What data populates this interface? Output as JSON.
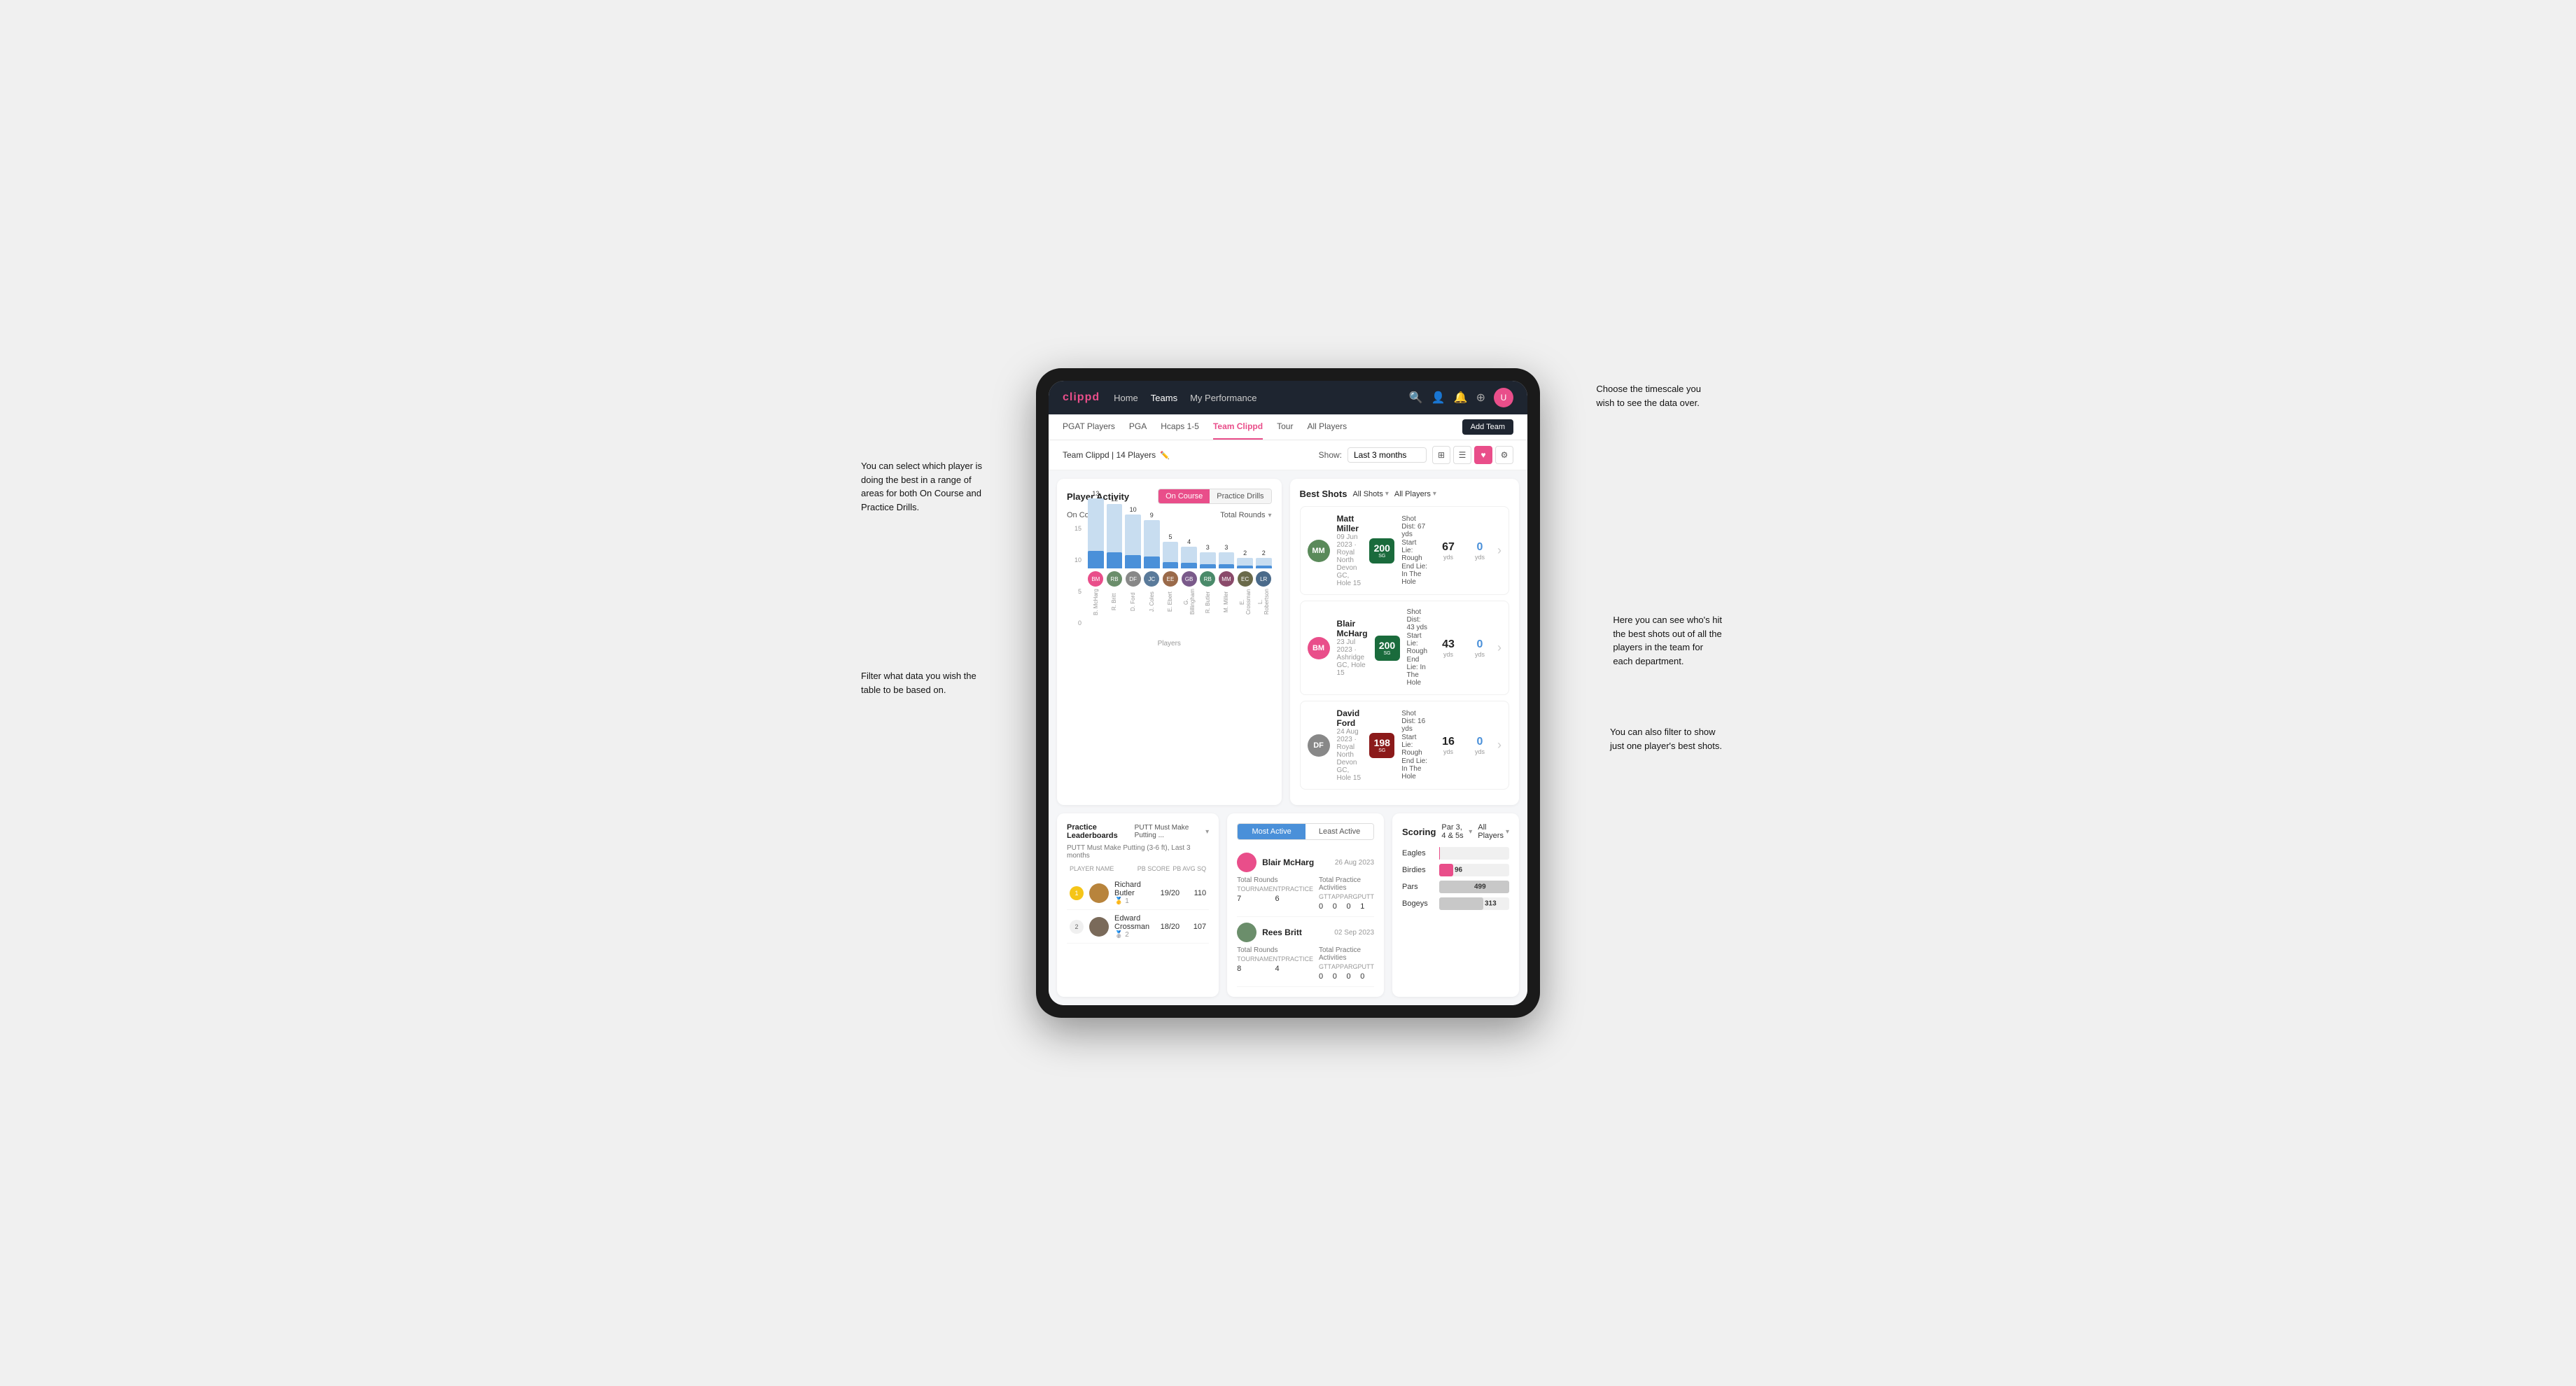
{
  "annotations": {
    "top_right": "Choose the timescale you\nwish to see the data over.",
    "left_top": "You can select which player is\ndoing the best in a range of\nareas for both On Course and\nPractice Drills.",
    "left_bottom": "Filter what data you wish the\ntable to be based on.",
    "right_mid": "Here you can see who's hit\nthe best shots out of all the\nplayers in the team for\neach department.",
    "right_bottom": "You can also filter to show\njust one player's best shots."
  },
  "nav": {
    "logo": "clippd",
    "links": [
      "Home",
      "Teams",
      "My Performance"
    ],
    "active": "Teams"
  },
  "subnav": {
    "tabs": [
      "PGAT Players",
      "PGA",
      "Hcaps 1-5",
      "Team Clippd",
      "Tour",
      "All Players"
    ],
    "active": "Team Clippd",
    "add_button": "Add Team"
  },
  "team_header": {
    "title": "Team Clippd | 14 Players",
    "show_label": "Show:",
    "show_value": "Last 3 months",
    "view_options": [
      "grid-view",
      "list-view",
      "heart-view",
      "settings-view"
    ]
  },
  "player_activity": {
    "title": "Player Activity",
    "toggle_options": [
      "On Course",
      "Practice Drills"
    ],
    "active_toggle": "On Course",
    "section_label": "On Course",
    "filter_label": "Total Rounds",
    "y_axis": [
      "15",
      "10",
      "5",
      "0"
    ],
    "x_axis_label": "Total Rounds",
    "players_label": "Players",
    "bars": [
      {
        "name": "B. McHarg",
        "value": 13,
        "color": "#b8cfe8"
      },
      {
        "name": "R. Britt",
        "value": 12,
        "color": "#b8cfe8"
      },
      {
        "name": "D. Ford",
        "value": 10,
        "color": "#b8cfe8"
      },
      {
        "name": "J. Coles",
        "value": 9,
        "color": "#b8cfe8"
      },
      {
        "name": "E. Ebert",
        "value": 5,
        "color": "#b8cfe8"
      },
      {
        "name": "G. Billingham",
        "value": 4,
        "color": "#b8cfe8"
      },
      {
        "name": "R. Butler",
        "value": 3,
        "color": "#b8cfe8"
      },
      {
        "name": "M. Miller",
        "value": 3,
        "color": "#b8cfe8"
      },
      {
        "name": "E. Crossman",
        "value": 2,
        "color": "#b8cfe8"
      },
      {
        "name": "L. Robertson",
        "value": 2,
        "color": "#b8cfe8"
      }
    ]
  },
  "best_shots": {
    "title": "Best Shots",
    "filter1": "All Shots",
    "filter2": "All Players",
    "shots": [
      {
        "player_name": "Matt Miller",
        "player_meta": "09 Jun 2023 · Royal North Devon GC, Hole 15",
        "badge": "200",
        "badge_sub": "SG",
        "details": [
          "Shot Dist: 67 yds",
          "Start Lie: Rough",
          "End Lie: In The Hole"
        ],
        "yds": "67",
        "zero": "0"
      },
      {
        "player_name": "Blair McHarg",
        "player_meta": "23 Jul 2023 · Ashridge GC, Hole 15",
        "badge": "200",
        "badge_sub": "SG",
        "details": [
          "Shot Dist: 43 yds",
          "Start Lie: Rough",
          "End Lie: In The Hole"
        ],
        "yds": "43",
        "zero": "0"
      },
      {
        "player_name": "David Ford",
        "player_meta": "24 Aug 2023 · Royal North Devon GC, Hole 15",
        "badge": "198",
        "badge_sub": "SG",
        "details": [
          "Shot Dist: 16 yds",
          "Start Lie: Rough",
          "End Lie: In The Hole"
        ],
        "yds": "16",
        "zero": "0"
      }
    ]
  },
  "practice_leaderboards": {
    "title": "Practice Leaderboards",
    "dropdown": "PUTT Must Make Putting ...",
    "subtitle": "PUTT Must Make Putting (3-6 ft), Last 3 months",
    "col_headers": [
      "PLAYER NAME",
      "PB SCORE",
      "PB AVG SQ"
    ],
    "rows": [
      {
        "rank": 1,
        "name": "Richard Butler",
        "score": "19/20",
        "avg": "110",
        "badge_emoji": "🥇"
      },
      {
        "rank": 2,
        "name": "Edward Crossman",
        "score": "18/20",
        "avg": "107",
        "badge_emoji": "🥈"
      }
    ]
  },
  "most_active": {
    "toggle_options": [
      "Most Active",
      "Least Active"
    ],
    "active_toggle": "Most Active",
    "players": [
      {
        "name": "Blair McHarg",
        "date": "26 Aug 2023",
        "total_rounds_label": "Total Rounds",
        "tournament": "7",
        "practice": "6",
        "total_practice_label": "Total Practice Activities",
        "gtt": "0",
        "app": "0",
        "arg": "0",
        "putt": "1"
      },
      {
        "name": "Rees Britt",
        "date": "02 Sep 2023",
        "total_rounds_label": "Total Rounds",
        "tournament": "8",
        "practice": "4",
        "total_practice_label": "Total Practice Activities",
        "gtt": "0",
        "app": "0",
        "arg": "0",
        "putt": "0"
      }
    ]
  },
  "scoring": {
    "title": "Scoring",
    "filter1": "Par 3, 4 & 5s",
    "filter2": "All Players",
    "bars": [
      {
        "label": "Eagles",
        "value": 3,
        "max": 499,
        "color": "#e94e8a"
      },
      {
        "label": "Birdies",
        "value": 96,
        "max": 499,
        "color": "#e94e8a"
      },
      {
        "label": "Pars",
        "value": 499,
        "max": 499,
        "color": "#b0b0b0"
      },
      {
        "label": "Bogeys",
        "value": 313,
        "max": 499,
        "color": "#b0b0b0"
      }
    ]
  }
}
